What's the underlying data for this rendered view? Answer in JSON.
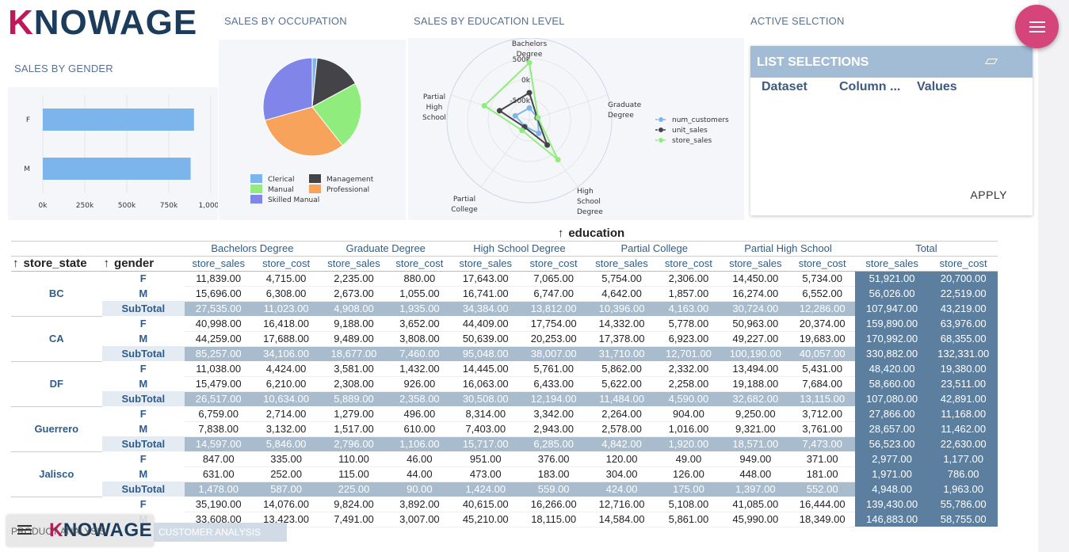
{
  "brand": {
    "logo_text": "KNOWAGE",
    "logo_accent": "K"
  },
  "titles": {
    "gender": "SALES BY GENDER",
    "occupation": "SALES BY OCCUPATION",
    "education": "SALES BY EDUCATION LEVEL",
    "active": "ACTIVE SELCTION"
  },
  "colors": {
    "brand": "#1c3c5c",
    "accent": "#c0195a",
    "fab": "#d6457a",
    "header_bg": "#a3bcd5",
    "subtotal": "#a8bccd",
    "total": "#5c7f9f"
  },
  "selections": {
    "header": "LIST SELECTIONS",
    "columns": [
      "Dataset",
      "Column ...",
      "Values"
    ],
    "apply": "APPLY",
    "clear_icon": "eraser-icon"
  },
  "menu_icon": "menu-icon",
  "chart_data": [
    {
      "type": "bar",
      "orientation": "horizontal",
      "categories": [
        "F",
        "M"
      ],
      "values": [
        900000,
        880000
      ],
      "xlim": [
        0,
        1000000
      ],
      "tick_labels": [
        "0k",
        "250k",
        "500k",
        "750k",
        "1,000k"
      ],
      "color": "#7cb5ec"
    },
    {
      "type": "pie",
      "labels": [
        "Clerical",
        "Management",
        "Manual",
        "Professional",
        "Skilled Manual"
      ],
      "values": [
        1.6,
        15.5,
        22.3,
        31.2,
        29.4
      ],
      "colors": [
        "#7cb5ec",
        "#434348",
        "#90ed7d",
        "#f7a35c",
        "#8085e9"
      ]
    },
    {
      "type": "radar",
      "axes": [
        "Bachelors Degree",
        "Graduate Degree",
        "High School Degree",
        "Partial College",
        "Partial High School"
      ],
      "axis_label_lines": [
        [
          "Bachelors",
          "Degree"
        ],
        [
          "Graduate",
          "Degree"
        ],
        [
          "High",
          "School",
          "Degree"
        ],
        [
          "Partial",
          "College"
        ],
        [
          "Partial",
          "High",
          "School"
        ]
      ],
      "radial_ticks": [
        "-500k",
        "0k",
        "500k"
      ],
      "rlim": [
        -1000000,
        1000000
      ],
      "series": [
        {
          "name": "num_customers",
          "color": "#7cb5ec",
          "values": [
            -700000,
            -790000,
            -610000,
            -820000,
            -640000
          ]
        },
        {
          "name": "unit_sales",
          "color": "#434348",
          "values": [
            -330000,
            -800000,
            -260000,
            -800000,
            -240000
          ]
        },
        {
          "name": "store_sales",
          "color": "#90ed7d",
          "values": [
            400000,
            -780000,
            180000,
            -700000,
            150000
          ]
        }
      ]
    }
  ],
  "pivot": {
    "column_field": "education",
    "row_fields": [
      "store_state",
      "gender"
    ],
    "degrees": [
      "Bachelors Degree",
      "Graduate Degree",
      "High School Degree",
      "Partial College",
      "Partial High School",
      "Total"
    ],
    "measures": [
      "store_sales",
      "store_cost"
    ],
    "groups": [
      {
        "state": "BC",
        "rows": [
          {
            "label": "F",
            "values": [
              "11,839.00",
              "4,715.00",
              "2,235.00",
              "880.00",
              "17,643.00",
              "7,065.00",
              "5,754.00",
              "2,306.00",
              "14,450.00",
              "5,734.00",
              "51,921.00",
              "20,700.00"
            ]
          },
          {
            "label": "M",
            "values": [
              "15,696.00",
              "6,308.00",
              "2,673.00",
              "1,055.00",
              "16,741.00",
              "6,747.00",
              "4,642.00",
              "1,857.00",
              "16,274.00",
              "6,552.00",
              "56,026.00",
              "22,519.00"
            ]
          },
          {
            "label": "SubTotal",
            "values": [
              "27,535.00",
              "11,023.00",
              "4,908.00",
              "1,935.00",
              "34,384.00",
              "13,812.00",
              "10,396.00",
              "4,163.00",
              "30,724.00",
              "12,286.00",
              "107,947.00",
              "43,219.00"
            ]
          }
        ]
      },
      {
        "state": "CA",
        "rows": [
          {
            "label": "F",
            "values": [
              "40,998.00",
              "16,418.00",
              "9,188.00",
              "3,652.00",
              "44,409.00",
              "17,754.00",
              "14,332.00",
              "5,778.00",
              "50,963.00",
              "20,374.00",
              "159,890.00",
              "63,976.00"
            ]
          },
          {
            "label": "M",
            "values": [
              "44,259.00",
              "17,688.00",
              "9,489.00",
              "3,808.00",
              "50,639.00",
              "20,253.00",
              "17,378.00",
              "6,923.00",
              "49,227.00",
              "19,683.00",
              "170,992.00",
              "68,355.00"
            ]
          },
          {
            "label": "SubTotal",
            "values": [
              "85,257.00",
              "34,106.00",
              "18,677.00",
              "7,460.00",
              "95,048.00",
              "38,007.00",
              "31,710.00",
              "12,701.00",
              "100,190.00",
              "40,057.00",
              "330,882.00",
              "132,331.00"
            ]
          }
        ]
      },
      {
        "state": "DF",
        "rows": [
          {
            "label": "F",
            "values": [
              "11,038.00",
              "4,424.00",
              "3,581.00",
              "1,432.00",
              "14,445.00",
              "5,761.00",
              "5,862.00",
              "2,332.00",
              "13,494.00",
              "5,431.00",
              "48,420.00",
              "19,380.00"
            ]
          },
          {
            "label": "M",
            "values": [
              "15,479.00",
              "6,210.00",
              "2,308.00",
              "926.00",
              "16,063.00",
              "6,433.00",
              "5,622.00",
              "2,258.00",
              "19,188.00",
              "7,684.00",
              "58,660.00",
              "23,511.00"
            ]
          },
          {
            "label": "SubTotal",
            "values": [
              "26,517.00",
              "10,634.00",
              "5,889.00",
              "2,358.00",
              "30,508.00",
              "12,194.00",
              "11,484.00",
              "4,590.00",
              "32,682.00",
              "13,115.00",
              "107,080.00",
              "42,891.00"
            ]
          }
        ]
      },
      {
        "state": "Guerrero",
        "rows": [
          {
            "label": "F",
            "values": [
              "6,759.00",
              "2,714.00",
              "1,279.00",
              "496.00",
              "8,314.00",
              "3,342.00",
              "2,264.00",
              "904.00",
              "9,250.00",
              "3,712.00",
              "27,866.00",
              "11,168.00"
            ]
          },
          {
            "label": "M",
            "values": [
              "7,838.00",
              "3,132.00",
              "1,517.00",
              "610.00",
              "7,403.00",
              "2,943.00",
              "2,578.00",
              "1,016.00",
              "9,321.00",
              "3,761.00",
              "28,657.00",
              "11,462.00"
            ]
          },
          {
            "label": "SubTotal",
            "values": [
              "14,597.00",
              "5,846.00",
              "2,796.00",
              "1,106.00",
              "15,717.00",
              "6,285.00",
              "4,842.00",
              "1,920.00",
              "18,571.00",
              "7,473.00",
              "56,523.00",
              "22,630.00"
            ]
          }
        ]
      },
      {
        "state": "Jalisco",
        "rows": [
          {
            "label": "F",
            "values": [
              "847.00",
              "335.00",
              "110.00",
              "46.00",
              "951.00",
              "376.00",
              "120.00",
              "49.00",
              "949.00",
              "371.00",
              "2,977.00",
              "1,177.00"
            ]
          },
          {
            "label": "M",
            "values": [
              "631.00",
              "252.00",
              "115.00",
              "44.00",
              "473.00",
              "183.00",
              "304.00",
              "126.00",
              "448.00",
              "181.00",
              "1,971.00",
              "786.00"
            ]
          },
          {
            "label": "SubTotal",
            "values": [
              "1,478.00",
              "587.00",
              "225.00",
              "90.00",
              "1,424.00",
              "559.00",
              "424.00",
              "175.00",
              "1,397.00",
              "552.00",
              "4,948.00",
              "1,963.00"
            ]
          }
        ]
      },
      {
        "state": "",
        "rows": [
          {
            "label": "F",
            "values": [
              "35,190.00",
              "14,076.00",
              "9,824.00",
              "3,892.00",
              "40,615.00",
              "16,266.00",
              "12,716.00",
              "5,108.00",
              "41,085.00",
              "16,444.00",
              "139,430.00",
              "55,786.00"
            ]
          },
          {
            "label": "M",
            "values": [
              "33,608.00",
              "13,423.00",
              "7,491.00",
              "3,007.00",
              "45,210.00",
              "18,115.00",
              "14,584.00",
              "5,861.00",
              "45,990.00",
              "18,349.00",
              "146,883.00",
              "58,755.00"
            ]
          }
        ]
      }
    ]
  },
  "taskbar": {
    "logo_text": "KNOWAGE",
    "doc_label": "PRODUCT ANALYSIS",
    "tab_label": "CUSTOMER ANALYSIS"
  }
}
